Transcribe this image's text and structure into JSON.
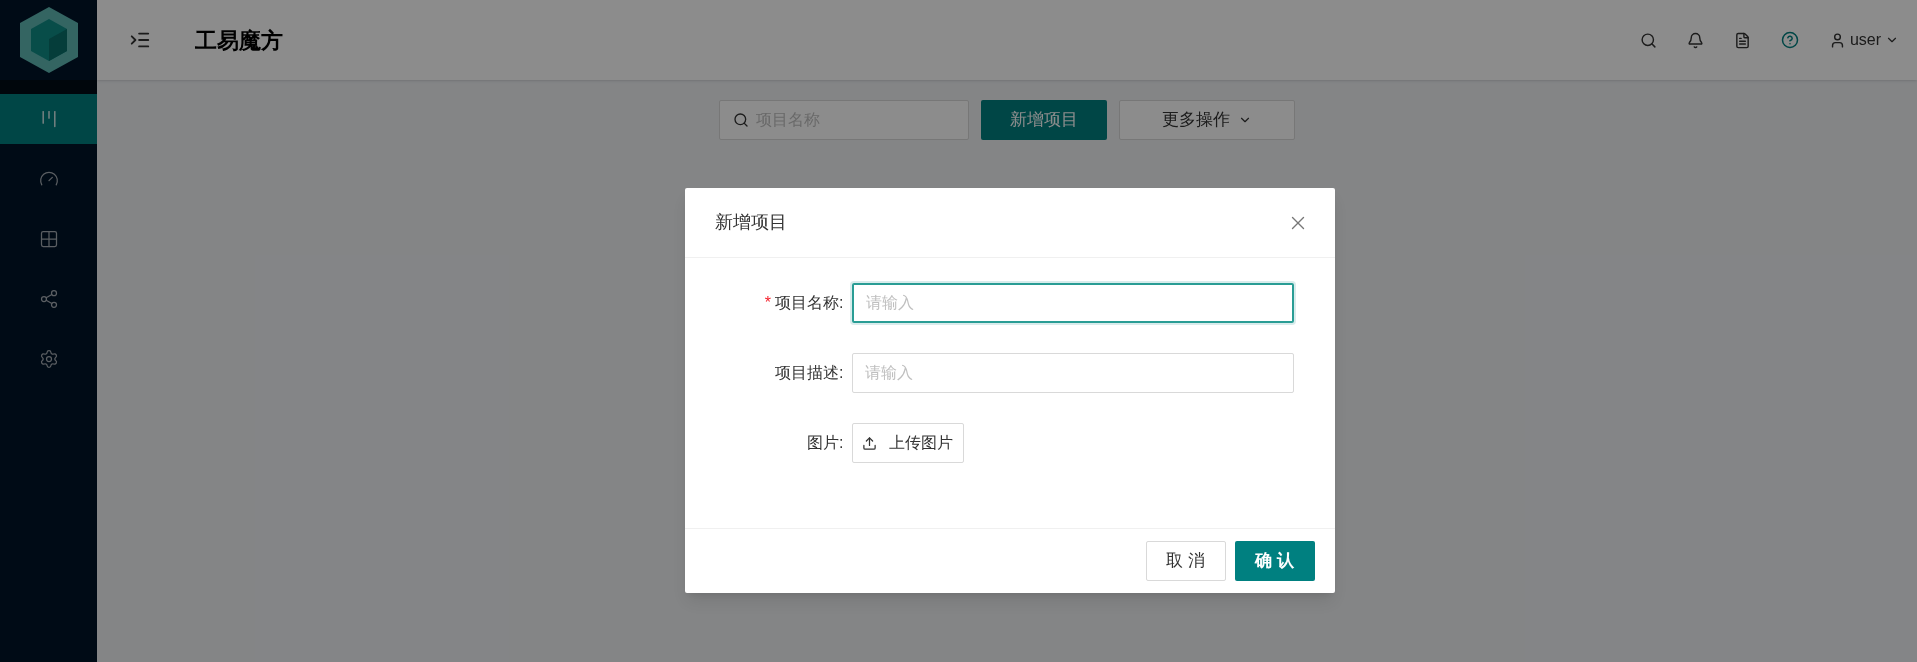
{
  "sidebar": {
    "items": [
      {
        "selected": true
      },
      {
        "selected": false
      },
      {
        "selected": false
      },
      {
        "selected": false
      },
      {
        "selected": false
      }
    ]
  },
  "header": {
    "title": "工易魔方",
    "user": "user"
  },
  "toolbar": {
    "search": {
      "placeholder": "项目名称"
    },
    "primary_button": "新增项目",
    "more_button": "更多操作"
  },
  "dialog": {
    "title": "新增项目",
    "fields": [
      {
        "kind": "input",
        "required_mark": "*",
        "label": "项目名称:",
        "focused": true,
        "placeholder": "请输入"
      },
      {
        "kind": "input",
        "label": "项目描述:",
        "focused": false,
        "placeholder": "请输入"
      },
      {
        "kind": "upload",
        "label": "图片:",
        "button": "上传图片"
      }
    ],
    "buttons": [
      {
        "kind": "default",
        "label": "取 消"
      },
      {
        "kind": "primary",
        "label": "确 认"
      }
    ]
  }
}
